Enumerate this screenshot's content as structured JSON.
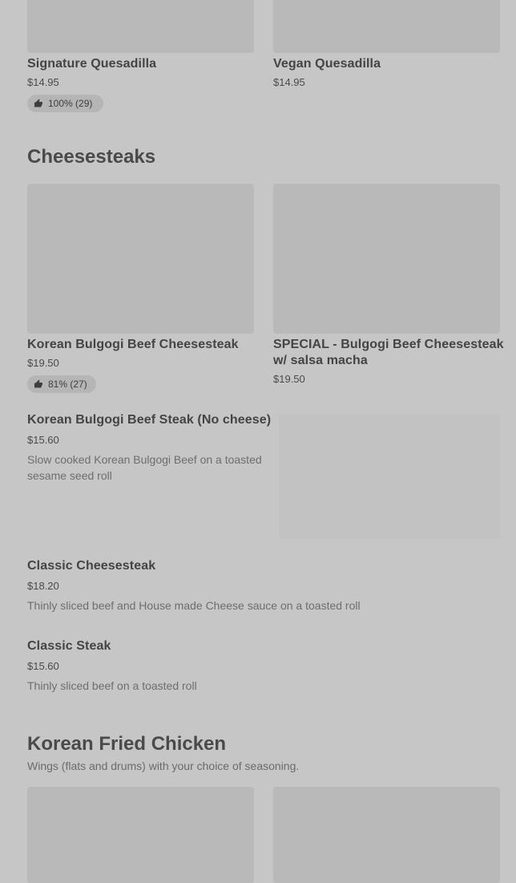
{
  "top_items": [
    {
      "name": "Signature Quesadilla",
      "price": "$14.95",
      "rating": "100% (29)"
    },
    {
      "name": "Vegan Quesadilla",
      "price": "$14.95"
    }
  ],
  "cheesesteaks": {
    "title": "Cheesesteaks",
    "grid_items": [
      {
        "name": "Korean Bulgogi Beef Cheesesteak",
        "price": "$19.50",
        "rating": "81% (27)"
      },
      {
        "name": "SPECIAL - Bulgogi Beef Cheesesteak w/ salsa macha",
        "price": "$19.50"
      }
    ],
    "list_items": [
      {
        "name": "Korean Bulgogi Beef Steak (No cheese)",
        "price": "$15.60",
        "description": "Slow cooked Korean Bulgogi Beef on a toasted sesame seed roll"
      },
      {
        "name": "Classic Cheesesteak",
        "price": "$18.20",
        "description": "Thinly sliced beef and House made Cheese sauce on a toasted roll"
      },
      {
        "name": "Classic Steak",
        "price": "$15.60",
        "description": "Thinly sliced beef on a toasted roll"
      }
    ]
  },
  "korean_fried_chicken": {
    "title": "Korean Fried Chicken",
    "subtitle": "Wings (flats and drums) with your choice of seasoning."
  },
  "icons": {
    "rating": "thumbs-up-icon"
  }
}
